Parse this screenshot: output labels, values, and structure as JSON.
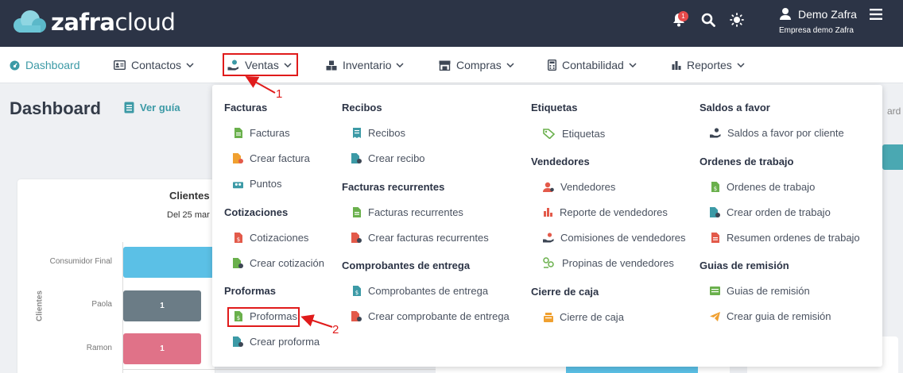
{
  "header": {
    "logo_bold": "zafra",
    "logo_light": "cloud",
    "notification_count": "1",
    "user_name": "Demo Zafra",
    "company": "Empresa demo Zafra"
  },
  "nav": {
    "dashboard": "Dashboard",
    "contactos": "Contactos",
    "ventas": "Ventas",
    "inventario": "Inventario",
    "compras": "Compras",
    "contabilidad": "Contabilidad",
    "reportes": "Reportes"
  },
  "page": {
    "title": "Dashboard",
    "guide": "Ver guía",
    "right_crumb": "ard"
  },
  "chart_card": {
    "title": "Clientes",
    "subtitle": "Del 25 mar",
    "axis_label": "Clientes",
    "categories": [
      "Consumidor Final",
      "Paola",
      "Ramon"
    ],
    "values": [
      "",
      "1",
      "1"
    ]
  },
  "menu": {
    "col1": {
      "facturas_head": "Facturas",
      "facturas": "Facturas",
      "crear_factura": "Crear factura",
      "puntos": "Puntos",
      "cotizaciones_head": "Cotizaciones",
      "cotizaciones": "Cotizaciones",
      "crear_cotizacion": "Crear cotización",
      "proformas_head": "Proformas",
      "proformas": "Proformas",
      "crear_proforma": "Crear proforma"
    },
    "col2": {
      "recibos_head": "Recibos",
      "recibos": "Recibos",
      "crear_recibo": "Crear recibo",
      "fact_rec_head": "Facturas recurrentes",
      "fact_rec": "Facturas recurrentes",
      "crear_fact_rec": "Crear facturas recurrentes",
      "comp_head": "Comprobantes de entrega",
      "comp": "Comprobantes de entrega",
      "crear_comp": "Crear comprobante de entrega"
    },
    "col3": {
      "etiquetas_head": "Etiquetas",
      "etiquetas": "Etiquetas",
      "vendedores_head": "Vendedores",
      "vendedores": "Vendedores",
      "reporte_vend": "Reporte de vendedores",
      "comisiones": "Comisiones de vendedores",
      "propinas": "Propinas de vendedores",
      "cierre_head": "Cierre de caja",
      "cierre": "Cierre de caja"
    },
    "col4": {
      "saldos_head": "Saldos a favor",
      "saldos": "Saldos a favor por cliente",
      "ordenes_head": "Ordenes de trabajo",
      "ordenes": "Ordenes de trabajo",
      "crear_orden": "Crear orden de trabajo",
      "resumen_ordenes": "Resumen ordenes de trabajo",
      "guias_head": "Guias de remisión",
      "guias": "Guias de remisión",
      "crear_guia": "Crear guia de remisión"
    }
  },
  "annotations": {
    "step1": "1",
    "step2": "2"
  },
  "colors": {
    "topbar": "#2c3446",
    "accent": "#3c9aa6",
    "annotation": "#e01b1b",
    "green_icon": "#6ab04c",
    "orange_icon": "#f0a030",
    "red_icon": "#e35a4a",
    "teal_icon": "#3c9aa6"
  }
}
